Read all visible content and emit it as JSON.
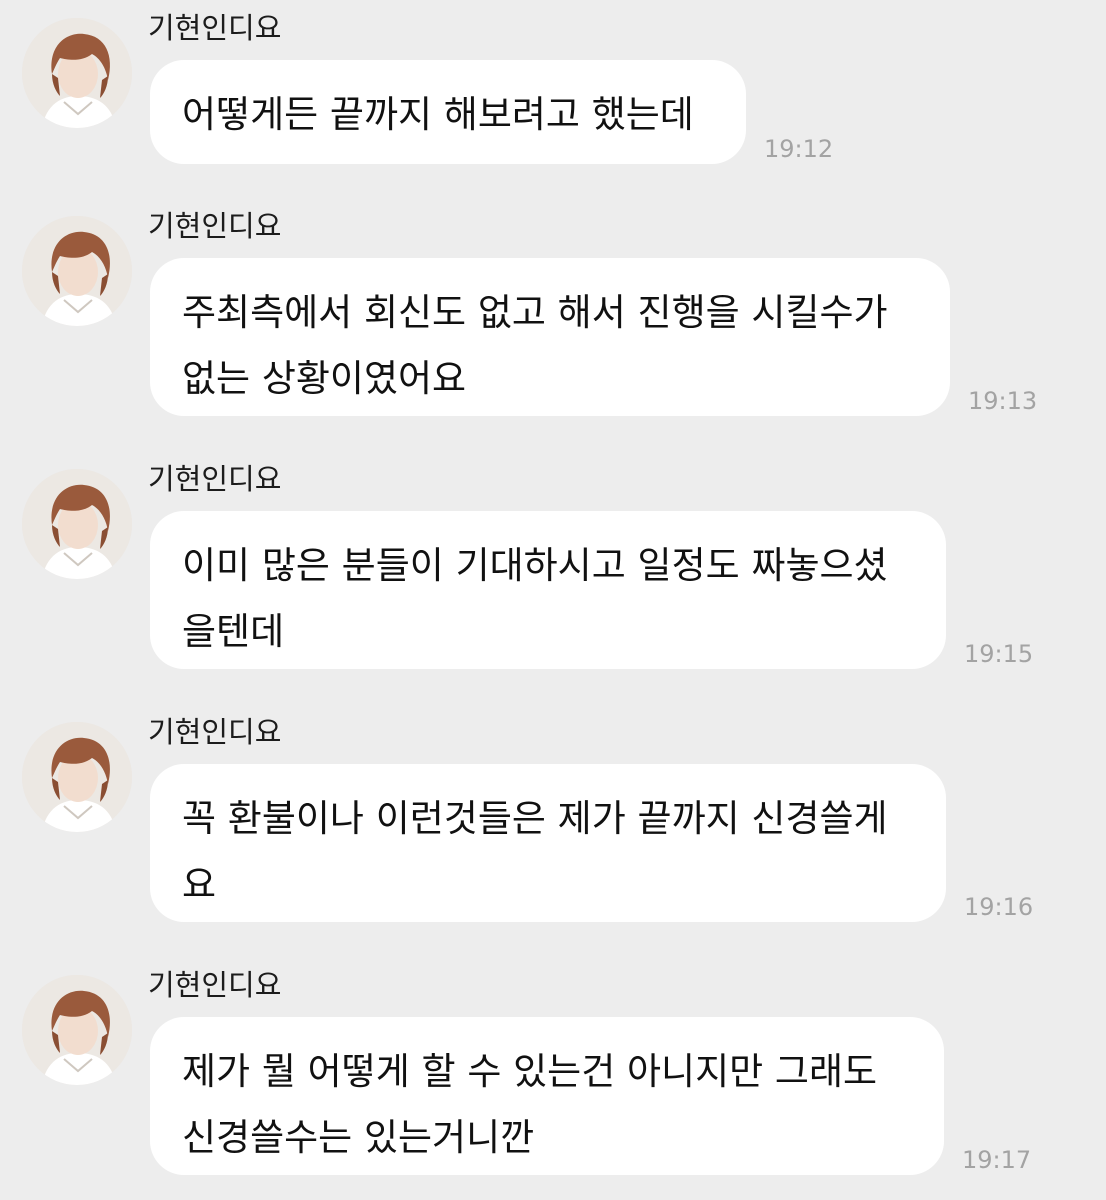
{
  "sender_name": "기현인디요",
  "messages": [
    {
      "lines": [
        "어떻게든 끝까지 해보려고 했는데"
      ],
      "time": "19:12"
    },
    {
      "lines": [
        "주최측에서 회신도 없고 해서 진행을 시킬수가",
        "없는 상황이였어요"
      ],
      "time": "19:13"
    },
    {
      "lines": [
        "이미 많은 분들이 기대하시고 일정도 짜놓으셨",
        "을텐데"
      ],
      "time": "19:15"
    },
    {
      "lines": [
        "꼭 환불이나 이런것들은 제가 끝까지 신경쓸게",
        "요"
      ],
      "time": "19:16"
    },
    {
      "lines": [
        "제가 뭘 어떻게 할 수 있는건 아니지만 그래도",
        "신경쓸수는 있는거니깐"
      ],
      "time": "19:17"
    }
  ],
  "icons": {
    "avatar": "profile-photo-icon"
  },
  "colors": {
    "background": "#ededed",
    "bubble": "#ffffff",
    "text": "#111111",
    "timestamp": "#a3a3a3"
  }
}
